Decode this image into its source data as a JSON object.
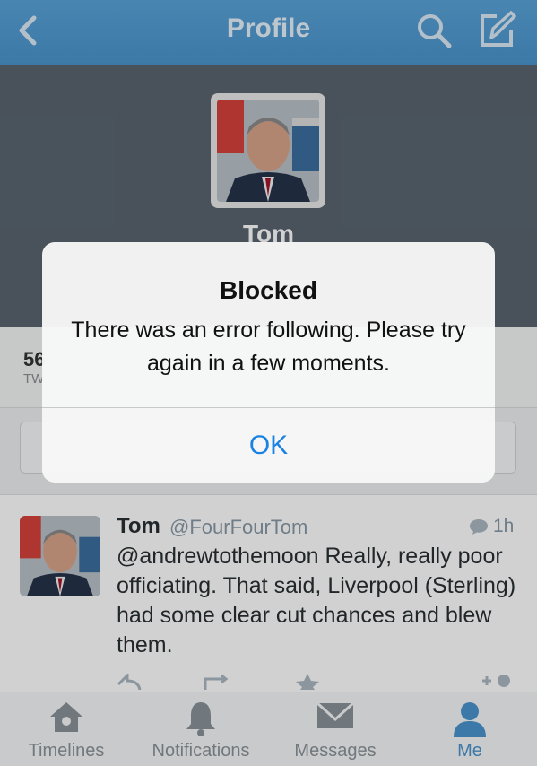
{
  "navbar": {
    "title": "Profile",
    "back_icon": "chevron-left-icon",
    "search_icon": "search-icon",
    "compose_icon": "compose-icon"
  },
  "profile": {
    "name": "Tom"
  },
  "stats": {
    "partial_number": "56",
    "partial_label": "TW"
  },
  "tweet": {
    "name": "Tom",
    "handle": "@FourFourTom",
    "time": "1h",
    "text": "@andrewtothemoon Really, really poor officiating. That said, Liverpool (Sterling) had some clear cut chances and blew them."
  },
  "tabs": [
    {
      "label": "Timelines",
      "icon": "home-icon",
      "active": false
    },
    {
      "label": "Notifications",
      "icon": "bell-icon",
      "active": false
    },
    {
      "label": "Messages",
      "icon": "envelope-icon",
      "active": false
    },
    {
      "label": "Me",
      "icon": "person-icon",
      "active": true
    }
  ],
  "alert": {
    "title": "Blocked",
    "message": "There was an error following. Please try again in a few moments.",
    "ok_label": "OK"
  },
  "colors": {
    "accent": "#4a94cd",
    "header_bg": "#596570",
    "alert_button": "#1a82e2"
  }
}
